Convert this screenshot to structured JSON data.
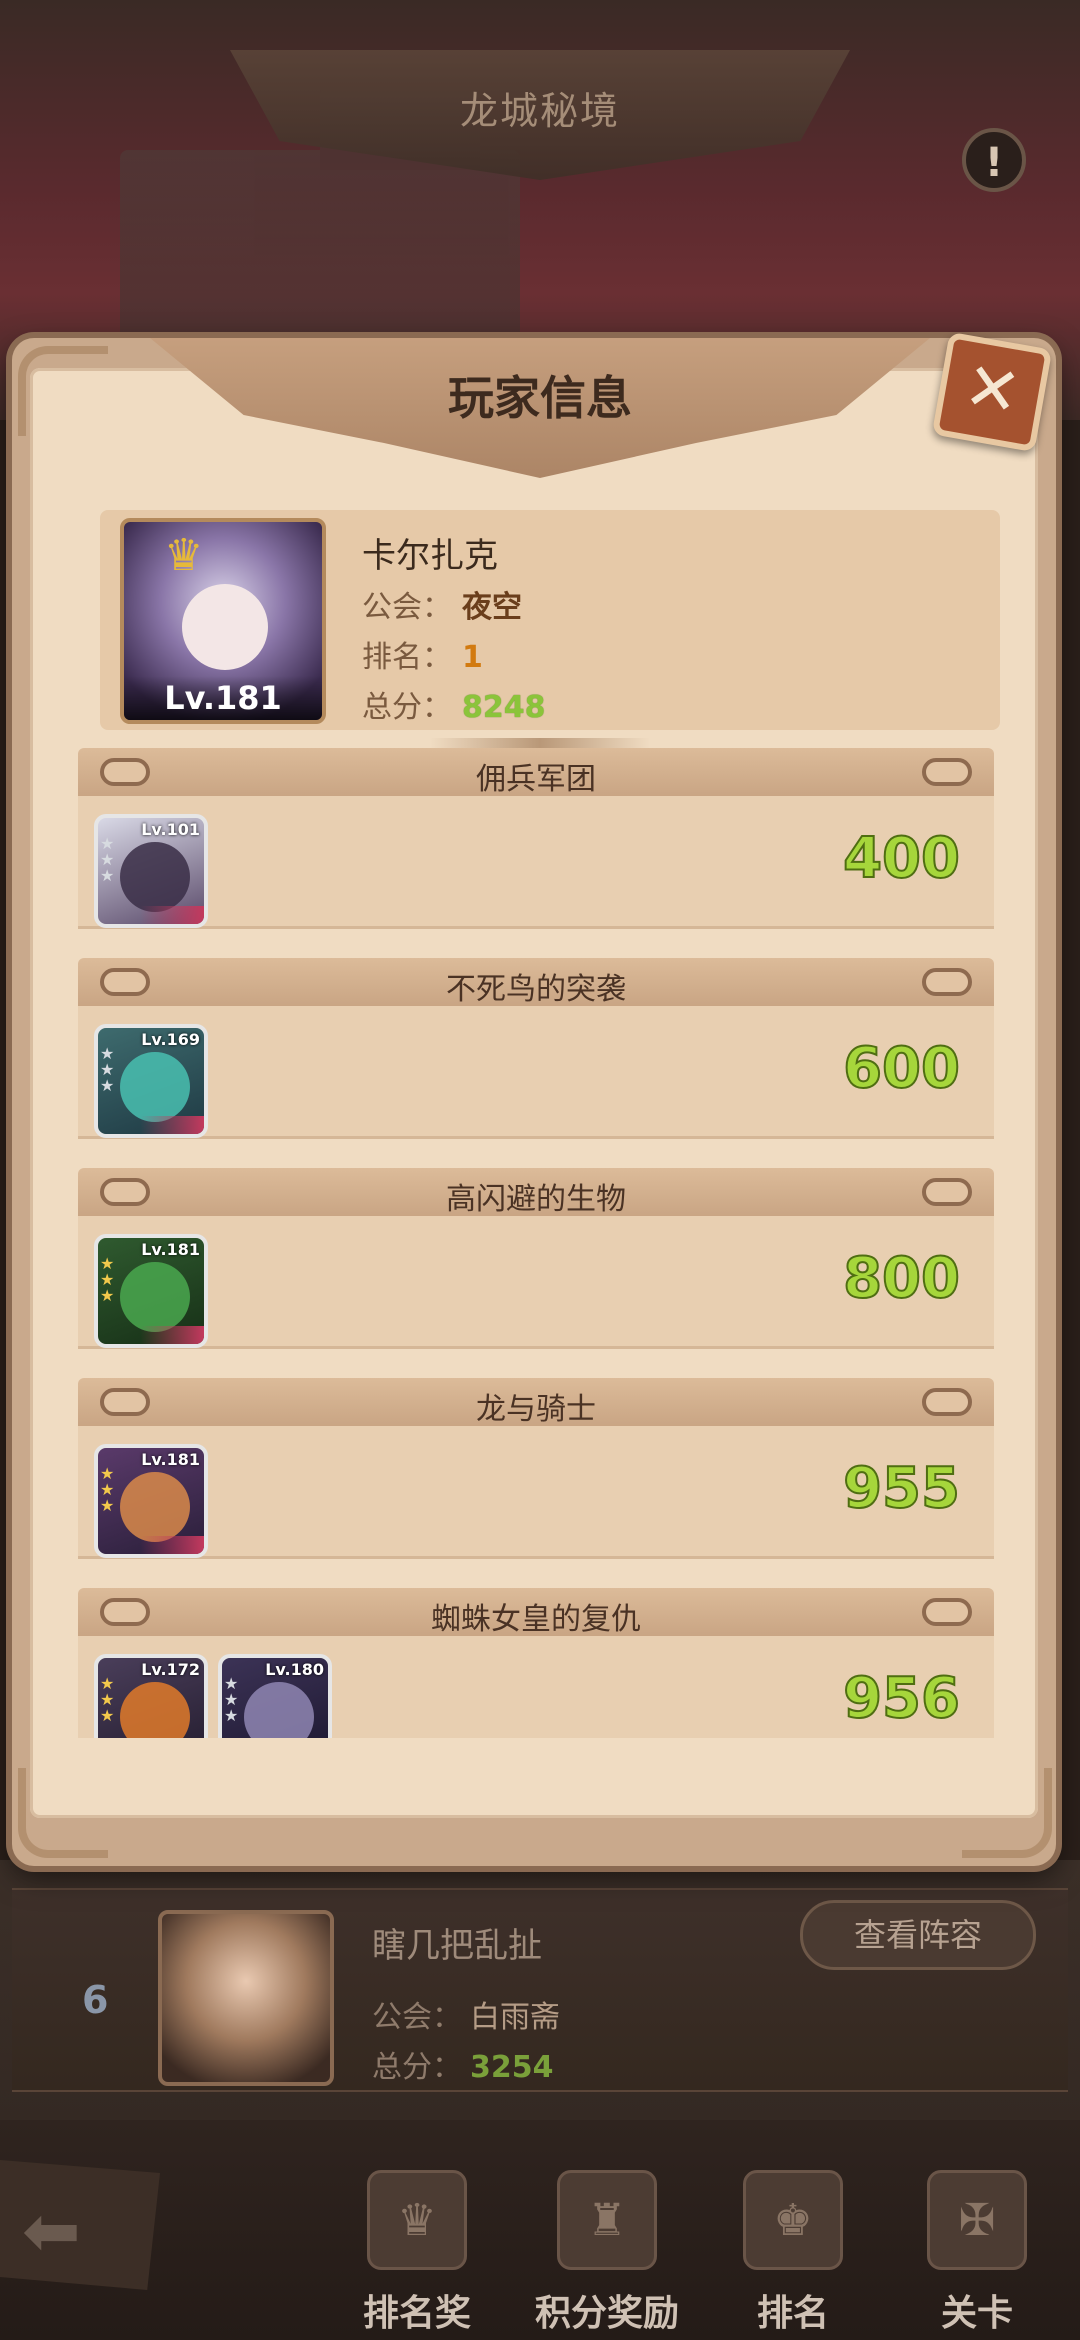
{
  "scene": {
    "title": "龙城秘境",
    "info_icon": "!"
  },
  "modal": {
    "title": "玩家信息",
    "close_icon": "✕",
    "player": {
      "name": "卡尔扎克",
      "level": "Lv.181",
      "guild_label": "公会：",
      "guild": "夜空",
      "rank_label": "排名：",
      "rank": "1",
      "score_label": "总分：",
      "score": "8248"
    },
    "sections": [
      {
        "title": "佣兵军团",
        "score": "400",
        "heroes": [
          {
            "level": "Lv.101"
          }
        ]
      },
      {
        "title": "不死鸟的突袭",
        "score": "600",
        "heroes": [
          {
            "level": "Lv.169"
          }
        ]
      },
      {
        "title": "高闪避的生物",
        "score": "800",
        "heroes": [
          {
            "level": "Lv.181"
          }
        ]
      },
      {
        "title": "龙与骑士",
        "score": "955",
        "heroes": [
          {
            "level": "Lv.181"
          }
        ]
      },
      {
        "title": "蜘蛛女皇的复仇",
        "score": "956",
        "heroes": [
          {
            "level": "Lv.172"
          },
          {
            "level": "Lv.180"
          }
        ]
      }
    ]
  },
  "rank_row": {
    "rank": "6",
    "name": "瞎几把乱扯",
    "guild_label": "公会：",
    "guild": "白雨斋",
    "score_label": "总分：",
    "score": "3254",
    "view_button": "查看阵容"
  },
  "nav": {
    "back_icon": "⬅",
    "items": [
      {
        "label": "排名奖",
        "icon": "rank-reward-icon"
      },
      {
        "label": "积分奖励",
        "icon": "points-reward-icon"
      },
      {
        "label": "排名",
        "icon": "ranking-icon"
      },
      {
        "label": "关卡",
        "icon": "stage-icon"
      }
    ]
  },
  "colors": {
    "score_green": "#a6d63b",
    "rank_orange": "#d27a10",
    "accent_red": "#a5522f"
  }
}
